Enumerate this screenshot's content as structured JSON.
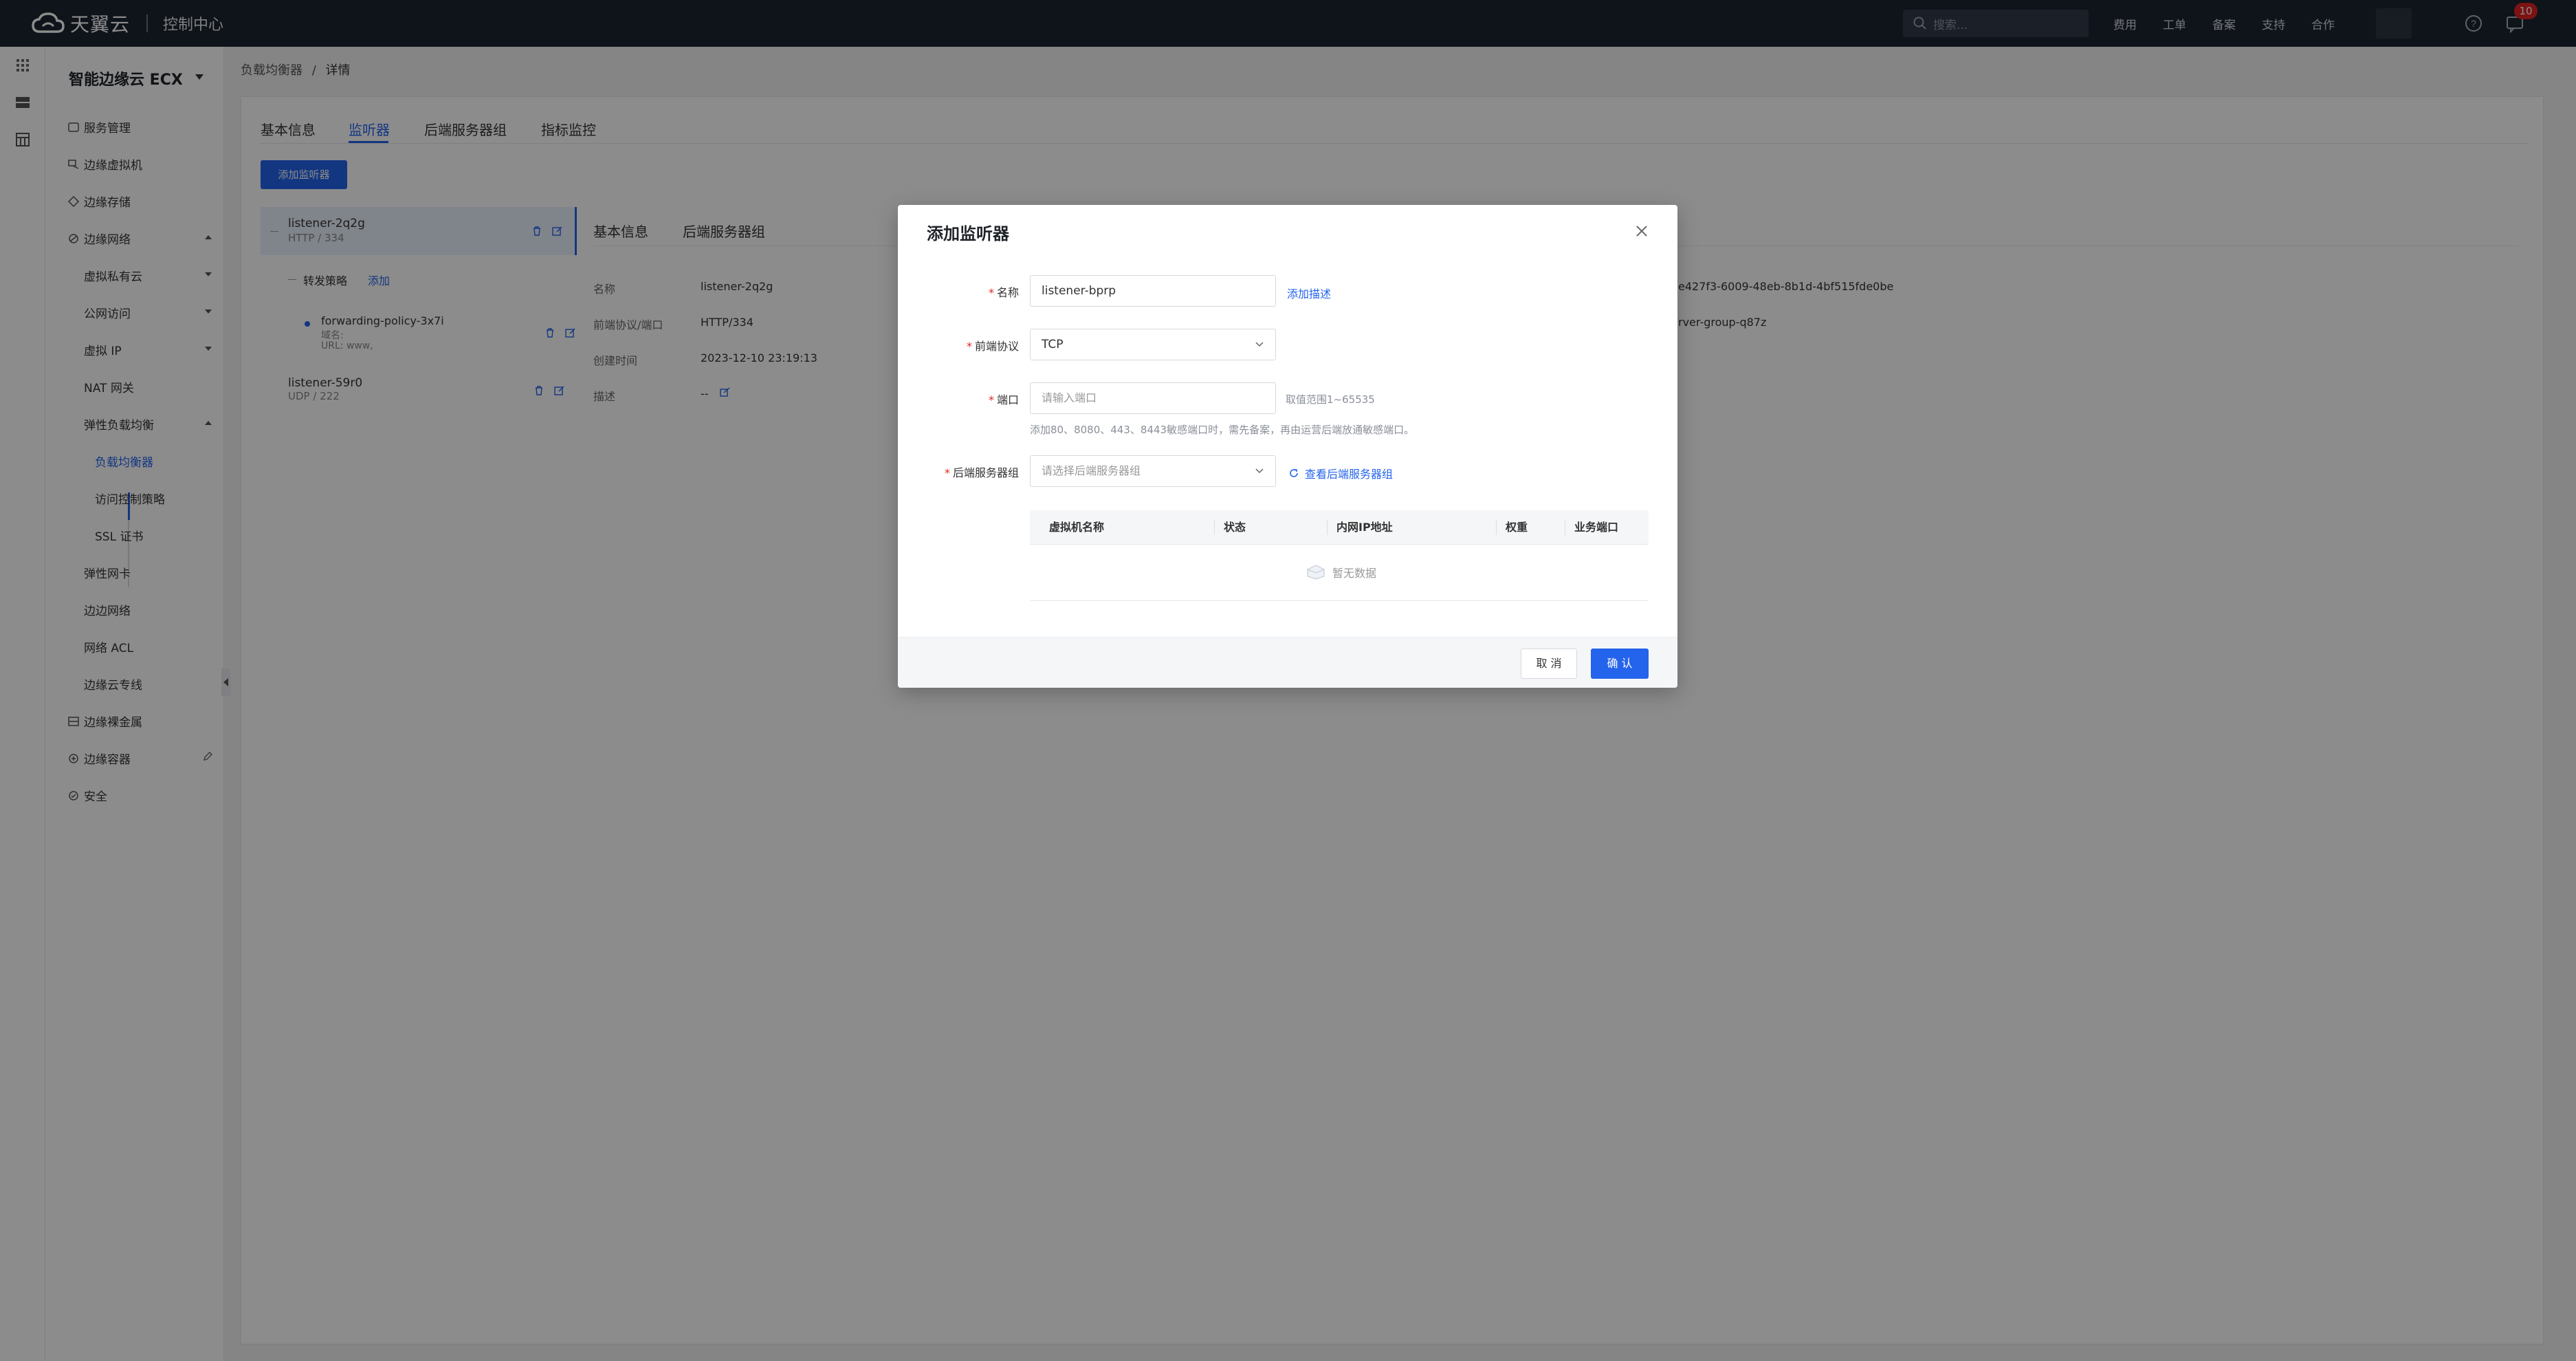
{
  "topbar": {
    "brand": "天翼云",
    "console": "控制中心",
    "search_placeholder": "搜索...",
    "nav": [
      "费用",
      "工单",
      "备案",
      "支持",
      "合作"
    ],
    "msg_count": "10"
  },
  "sidebar": {
    "title": "智能边缘云 ECX",
    "items": {
      "service_mgmt": "服务管理",
      "edge_vm": "边缘虚拟机",
      "edge_storage": "边缘存储",
      "edge_network": "边缘网络",
      "vpc": "虚拟私有云",
      "public_access": "公网访问",
      "virtual_ip": "虚拟 IP",
      "nat": "NAT 网关",
      "elb": "弹性负载均衡",
      "lb": "负载均衡器",
      "acl_policy": "访问控制策略",
      "ssl": "SSL 证书",
      "eni": "弹性网卡",
      "edge_net": "边边网络",
      "net_acl": "网络 ACL",
      "edge_cloud_line": "边缘云专线",
      "bare_metal": "边缘裸金属",
      "container": "边缘容器",
      "security": "安全"
    }
  },
  "breadcrumb": {
    "parent": "负载均衡器",
    "sep": "/",
    "current": "详情"
  },
  "tabs": [
    "基本信息",
    "监听器",
    "后端服务器组",
    "指标监控"
  ],
  "add_listener_button": "添加监听器",
  "listeners": [
    {
      "name": "listener-2q2g",
      "sub": "HTTP / 334"
    },
    {
      "name": "listener-59r0",
      "sub": "UDP / 222"
    }
  ],
  "forwarding": {
    "label": "转发策略",
    "add": "添加",
    "policy_name": "forwarding-policy-3x7i",
    "domain_label": "域名:",
    "url_label": "URL: www,"
  },
  "detail": {
    "tabs": [
      "基本信息",
      "后端服务器组"
    ],
    "rows": [
      {
        "k": "名称",
        "v": "listener-2q2g"
      },
      {
        "k": "前端协议/端口",
        "v": "HTTP/334"
      },
      {
        "k": "创建时间",
        "v": "2023-12-10 23:19:13"
      },
      {
        "k": "描述",
        "v": "--"
      }
    ],
    "id_text": "e427f3-6009-48eb-8b1d-4bf515fde0be",
    "group_text": "rver-group-q87z"
  },
  "modal": {
    "title": "添加监听器",
    "fields": {
      "name_label": "名称",
      "name_value": "listener-bprp",
      "add_desc": "添加描述",
      "protocol_label": "前端协议",
      "protocol_value": "TCP",
      "port_label": "端口",
      "port_placeholder": "请输入端口",
      "port_range": "取值范围1~65535",
      "port_hint": "添加80、8080、443、8443敏感端口时，需先备案，再由运营后端放通敏感端口。",
      "group_label": "后端服务器组",
      "group_placeholder": "请选择后端服务器组",
      "view_group": "查看后端服务器组"
    },
    "table": {
      "headers": [
        "虚拟机名称",
        "状态",
        "内网IP地址",
        "权重",
        "业务端口"
      ],
      "empty": "暂无数据"
    },
    "cancel": "取 消",
    "ok": "确 认"
  }
}
